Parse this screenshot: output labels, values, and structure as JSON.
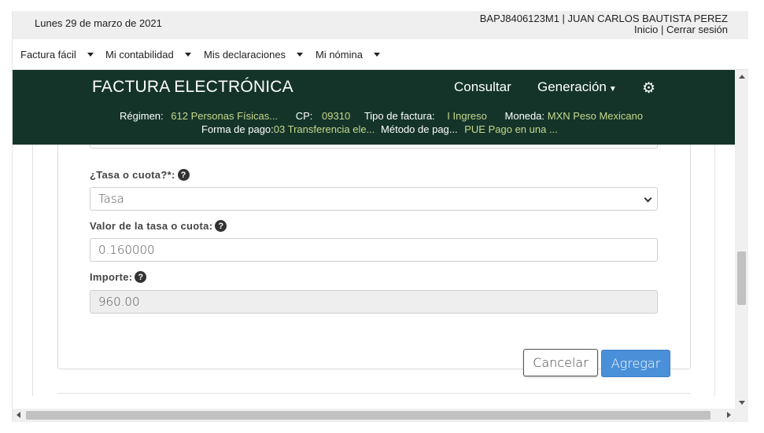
{
  "topbar": {
    "date": "Lunes 29 de marzo de 2021",
    "user": "BAPJ8406123M1 | JUAN CARLOS BAUTISTA PEREZ",
    "inicio": "Inicio",
    "separator": " | ",
    "logout": "Cerrar sesión"
  },
  "menu": {
    "items": [
      {
        "label": "Factura fácil"
      },
      {
        "label": "Mi contabilidad"
      },
      {
        "label": "Mis declaraciones"
      },
      {
        "label": "Mi nómina"
      }
    ]
  },
  "header": {
    "title": "FACTURA ELECTRÓNICA",
    "nav_consultar": "Consultar",
    "nav_generacion": "Generación",
    "gear_icon": "gear-icon",
    "regimen_label": "Régimen:",
    "regimen_value": "612 Personas Físicas...",
    "cp_label": "CP:",
    "cp_value": "09310",
    "tipo_label": "Tipo de factura:",
    "tipo_value": "I Ingreso",
    "moneda_label": "Moneda:",
    "moneda_value": "MXN Peso Mexicano",
    "forma_label": "Forma de pago:",
    "forma_value": "03 Transferencia ele...",
    "metodo_label": "Método de pag...",
    "metodo_value": "PUE Pago en una ..."
  },
  "form": {
    "tasa_label": "¿Tasa o cuota?*:",
    "tasa_value": "Tasa",
    "valor_label": "Valor de la tasa o cuota:",
    "valor_value": "0.160000",
    "importe_label": "Importe:",
    "importe_value": "960.00",
    "help_glyph": "?"
  },
  "buttons": {
    "cancel": "Cancelar",
    "add": "Agregar"
  },
  "colors": {
    "header_bg": "#14342a",
    "header_value": "#c7d88a",
    "primary_button": "#4a90d9"
  }
}
